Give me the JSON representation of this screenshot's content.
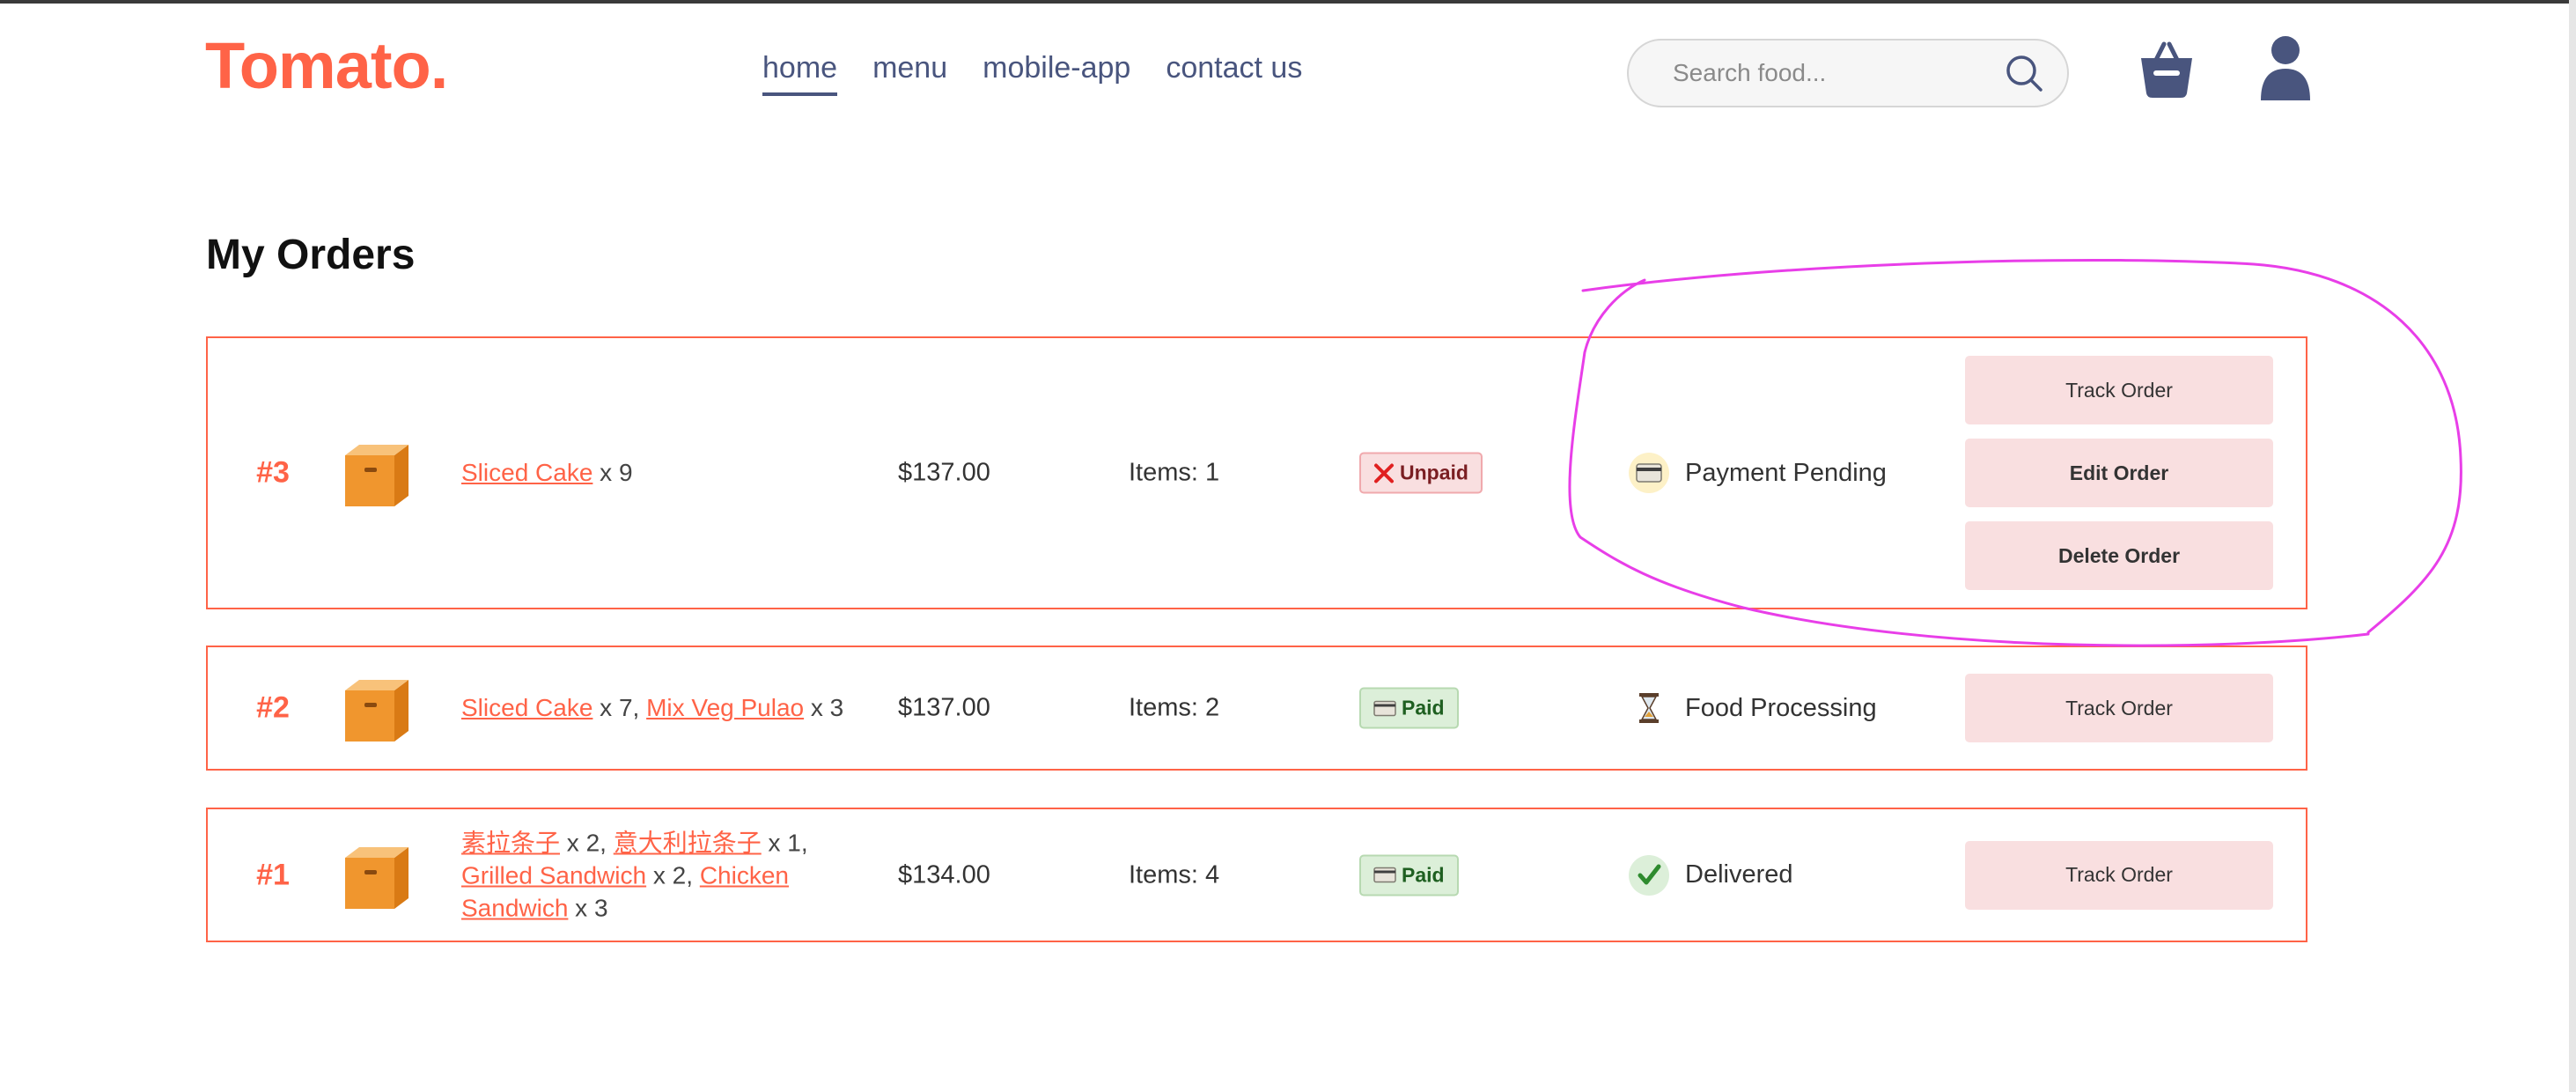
{
  "brand": {
    "logo": "Tomato.",
    "accent": "#ff6347"
  },
  "nav": [
    {
      "label": "home",
      "active": true
    },
    {
      "label": "menu"
    },
    {
      "label": "mobile-app"
    },
    {
      "label": "contact us"
    }
  ],
  "search": {
    "placeholder": "Search food..."
  },
  "header_icons": [
    "search-icon",
    "basket-icon",
    "user-icon"
  ],
  "page": {
    "title": "My Orders"
  },
  "orders": [
    {
      "number": "#3",
      "items": [
        {
          "name": "Sliced Cake",
          "qty": " x 9"
        }
      ],
      "amount": "$137.00",
      "count": "Items: 1",
      "payment": {
        "label": "Unpaid",
        "icon": "x-icon"
      },
      "status": {
        "label": "Payment Pending",
        "icon": "card-icon"
      },
      "actions": [
        "Track Order",
        "Edit Order",
        "Delete Order"
      ]
    },
    {
      "number": "#2",
      "items": [
        {
          "name": "Sliced Cake",
          "qty": " x 7, "
        },
        {
          "name": "Mix Veg Pulao",
          "qty": " x 3"
        }
      ],
      "amount": "$137.00",
      "count": "Items: 2",
      "payment": {
        "label": "Paid",
        "icon": "card-icon"
      },
      "status": {
        "label": "Food Processing",
        "icon": "hourglass-icon"
      },
      "actions": [
        "Track Order"
      ]
    },
    {
      "number": "#1",
      "items": [
        {
          "name": "素拉条子",
          "qty": " x 2, "
        },
        {
          "name": "意大利拉条子",
          "qty": " x 1, "
        },
        {
          "name": "Grilled Sandwich",
          "qty": " x 2, "
        },
        {
          "name": "Chicken Sandwich",
          "qty": " x 3"
        }
      ],
      "amount": "$134.00",
      "count": "Items: 4",
      "payment": {
        "label": "Paid",
        "icon": "card-icon"
      },
      "status": {
        "label": "Delivered",
        "icon": "check-icon"
      },
      "actions": [
        "Track Order"
      ]
    }
  ],
  "annotation": {
    "color": "#e83ee8"
  }
}
